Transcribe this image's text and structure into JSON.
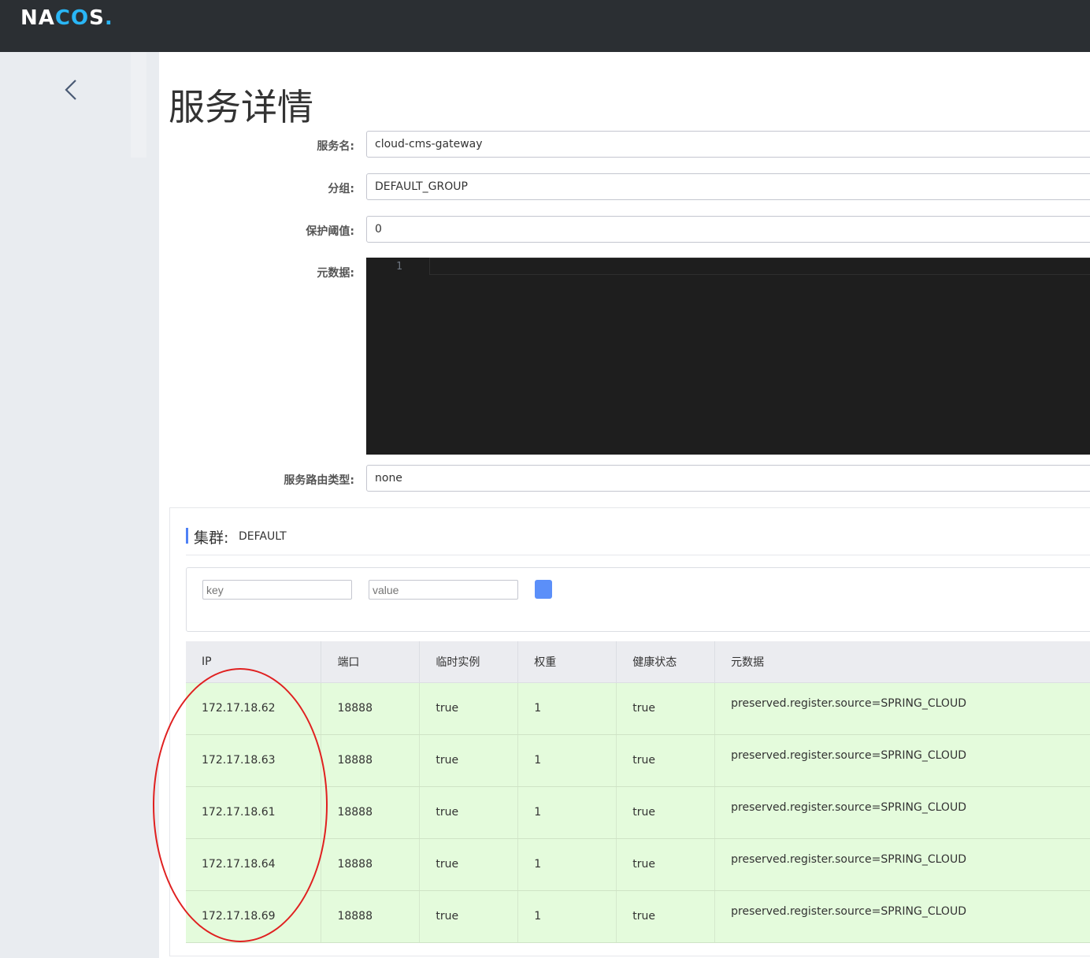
{
  "header": {
    "logo": {
      "na": "NA",
      "oo": "CO",
      "s": "S",
      "dot": "."
    }
  },
  "page": {
    "title": "服务详情"
  },
  "form": {
    "service_name_label": "服务名:",
    "service_name_value": "cloud-cms-gateway",
    "group_label": "分组:",
    "group_value": "DEFAULT_GROUP",
    "threshold_label": "保护阈值:",
    "threshold_value": "0",
    "metadata_label": "元数据:",
    "editor_line_number": "1",
    "routing_label": "服务路由类型:",
    "routing_value": "none"
  },
  "cluster": {
    "label": "集群:",
    "name": "DEFAULT",
    "filter": {
      "key_placeholder": "key",
      "value_placeholder": "value"
    },
    "table": {
      "headers": [
        "IP",
        "端口",
        "临时实例",
        "权重",
        "健康状态",
        "元数据"
      ],
      "rows": [
        [
          "172.17.18.62",
          "18888",
          "true",
          "1",
          "true",
          "preserved.register.source=SPRING_CLOUD"
        ],
        [
          "172.17.18.63",
          "18888",
          "true",
          "1",
          "true",
          "preserved.register.source=SPRING_CLOUD"
        ],
        [
          "172.17.18.61",
          "18888",
          "true",
          "1",
          "true",
          "preserved.register.source=SPRING_CLOUD"
        ],
        [
          "172.17.18.64",
          "18888",
          "true",
          "1",
          "true",
          "preserved.register.source=SPRING_CLOUD"
        ],
        [
          "172.17.18.69",
          "18888",
          "true",
          "1",
          "true",
          "preserved.register.source=SPRING_CLOUD"
        ]
      ]
    }
  },
  "colors": {
    "topbar": "#2b2f33",
    "accent": "#5b8ff9",
    "healthy_row": "#e4fbdc",
    "annotation": "#e02020"
  }
}
